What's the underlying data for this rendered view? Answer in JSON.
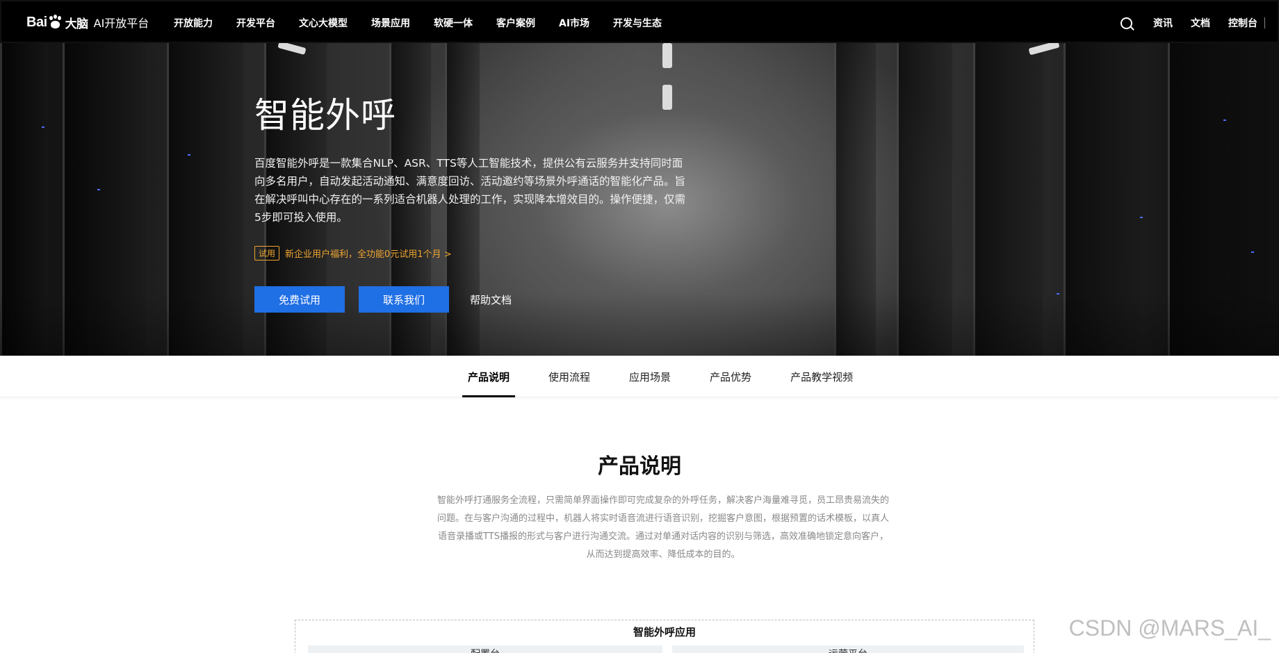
{
  "nav": {
    "logo_latin": "Bai",
    "logo_cn": "大脑",
    "logo_sub": "AI开放平台",
    "items": [
      {
        "label": "开放能力"
      },
      {
        "label": "开发平台"
      },
      {
        "label": "文心大模型"
      },
      {
        "label": "场景应用"
      },
      {
        "label": "软硬一体"
      },
      {
        "label": "客户案例"
      },
      {
        "label": "AI市场"
      },
      {
        "label": "开发与生态"
      }
    ],
    "right_items": [
      {
        "label": "资讯"
      },
      {
        "label": "文档"
      },
      {
        "label": "控制台"
      }
    ]
  },
  "hero": {
    "title": "智能外呼",
    "description": "百度智能外呼是一款集合NLP、ASR、TTS等人工智能技术，提供公有云服务并支持同时面向多名用户，自动发起活动通知、满意度回访、活动邀约等场景外呼通话的智能化产品。旨在解决呼叫中心存在的一系列适合机器人处理的工作，实现降本增效目的。操作便捷，仅需5步即可投入使用。",
    "trial_badge": "试用",
    "trial_text": "新企业用户福利，全功能0元试用1个月 >",
    "btn_trial": "免费试用",
    "btn_contact": "联系我们",
    "btn_docs": "帮助文档"
  },
  "tabs": [
    {
      "label": "产品说明",
      "active": true
    },
    {
      "label": "使用流程",
      "active": false
    },
    {
      "label": "应用场景",
      "active": false
    },
    {
      "label": "产品优势",
      "active": false
    },
    {
      "label": "产品教学视频",
      "active": false
    }
  ],
  "section": {
    "title": "产品说明",
    "description": "智能外呼打通服务全流程，只需简单界面操作即可完成复杂的外呼任务，解决客户海量难寻觅，员工昂贵易流失的问题。在与客户沟通的过程中，机器人将实时语音流进行语音识别，挖掘客户意图，根据预置的话术模板，以真人语音录播或TTS播报的形式与客户进行沟通交流。通过对单通对话内容的识别与筛选，高效准确地锁定意向客户，从而达到提高效率、降低成本的目的。"
  },
  "app_box": {
    "title": "智能外呼应用",
    "left_panel": "配置台",
    "right_panel": "运营平台"
  },
  "watermark": "CSDN @MARS_AI_",
  "colors": {
    "accent_blue": "#1f6fe5",
    "trial_orange": "#f0a530",
    "nav_bg": "#000000"
  }
}
